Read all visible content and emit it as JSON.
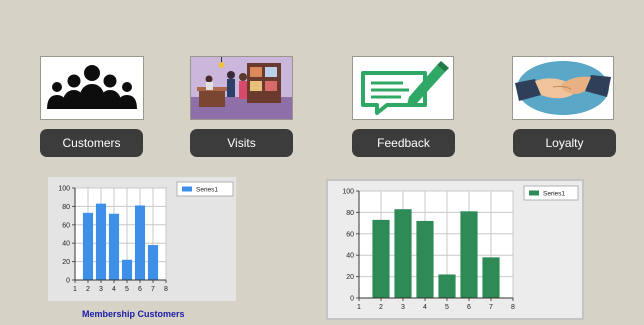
{
  "nav": {
    "customers": {
      "label": "Customers",
      "icon": "customers-group-icon"
    },
    "visits": {
      "label": "Visits",
      "icon": "visits-store-illustration"
    },
    "feedback": {
      "label": "Feedback",
      "icon": "feedback-message-icon"
    },
    "loyalty": {
      "label": "Loyalty",
      "icon": "loyalty-handshake-icon"
    }
  },
  "colors": {
    "background": "#d6d2c6",
    "button": "#3c3c3c",
    "chart_left_series": "#3d8fe8",
    "chart_right_series": "#2e8b57",
    "caption": "#1a1aa8",
    "feedback_green": "#2fa866"
  },
  "charts": {
    "left_caption": "Membership Customers"
  },
  "chart_data": [
    {
      "type": "bar",
      "x": [
        2,
        3,
        4,
        5,
        6,
        7
      ],
      "series": [
        {
          "name": "Series1",
          "values": [
            73,
            83,
            72,
            22,
            81,
            38
          ]
        }
      ],
      "xlim": [
        1,
        8
      ],
      "x_ticks": [
        "1",
        "2",
        "3",
        "4",
        "5",
        "6",
        "7",
        "8"
      ],
      "ylim": [
        0,
        100
      ],
      "y_ticks": [
        "0",
        "20",
        "40",
        "60",
        "80",
        "100"
      ],
      "grid": true,
      "legend": "top-right",
      "title": "Membership Customers"
    },
    {
      "type": "bar",
      "x": [
        2,
        3,
        4,
        5,
        6,
        7
      ],
      "series": [
        {
          "name": "Series1",
          "values": [
            73,
            83,
            72,
            22,
            81,
            38
          ]
        }
      ],
      "xlim": [
        1,
        8
      ],
      "x_ticks": [
        "1",
        "2",
        "3",
        "4",
        "5",
        "6",
        "7",
        "8"
      ],
      "ylim": [
        0,
        100
      ],
      "y_ticks": [
        "0",
        "20",
        "40",
        "60",
        "80",
        "100"
      ],
      "grid": true,
      "legend": "top-right"
    }
  ]
}
